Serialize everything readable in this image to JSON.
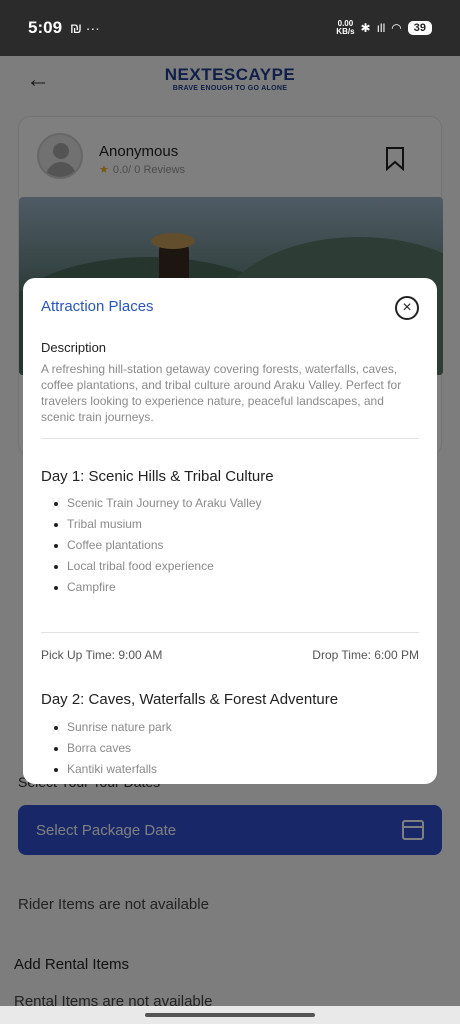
{
  "status_bar": {
    "time": "5:09",
    "left_extra": "₪ ···",
    "speed_value": "0.00",
    "speed_unit": "KB/s",
    "signal": "ıll",
    "battery": "39"
  },
  "header": {
    "brand_name": "NEXTESCAYPE",
    "brand_tagline": "BRAVE ENOUGH TO GO ALONE"
  },
  "review": {
    "user_name": "Anonymous",
    "rating_text": "0.0/ 0 Reviews"
  },
  "booking": {
    "select_dates_label": "Select Your Tour Dates",
    "select_date_button": "Select Package Date",
    "rider_items_text": "Rider Items are not available",
    "rental_title": "Add Rental Items",
    "rental_text": "Rental Items are not available"
  },
  "modal": {
    "title": "Attraction Places",
    "description_heading": "Description",
    "description": "A refreshing hill-station getaway covering forests, waterfalls, caves, coffee plantations, and tribal culture around Araku Valley. Perfect for travelers looking to experience nature, peaceful landscapes, and scenic train journeys.",
    "days": [
      {
        "title": "Day 1: Scenic Hills & Tribal Culture",
        "items": [
          "Scenic Train Journey to Araku Valley",
          "Tribal musium",
          "Coffee plantations",
          "Local tribal food experience",
          "Campfire"
        ],
        "pickup": "Pick Up Time: 9:00 AM",
        "drop": "Drop Time: 6:00 PM"
      },
      {
        "title": "Day 2: Caves, Waterfalls & Forest Adventure",
        "items": [
          "Sunrise nature park",
          "Borra caves",
          "Kantiki waterfalls"
        ]
      }
    ]
  }
}
